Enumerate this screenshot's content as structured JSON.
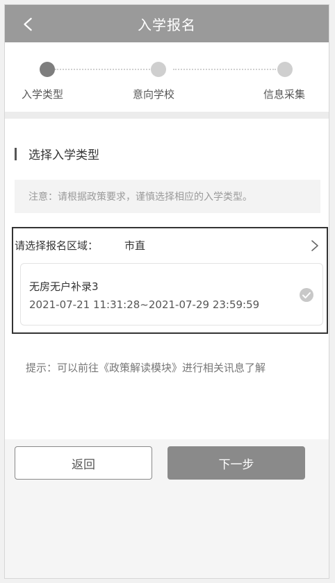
{
  "header": {
    "title": "入学报名",
    "back_icon": "chevron-left-icon"
  },
  "steps": [
    {
      "label": "入学类型",
      "active": true
    },
    {
      "label": "意向学校",
      "active": false
    },
    {
      "label": "信息采集",
      "active": false
    }
  ],
  "section": {
    "title": "选择入学类型",
    "notice": "注意：请根据政策要求，谨慎选择相应的入学类型。"
  },
  "region": {
    "label": "请选择报名区域：",
    "value": "市直"
  },
  "option": {
    "name": "无房无户补录3",
    "time": "2021-07-21 11:31:28~2021-07-29 23:59:59",
    "selected": true
  },
  "hint": "提示：可以前往《政策解读模块》进行相关讯息了解",
  "buttons": {
    "back": "返回",
    "next": "下一步"
  },
  "colors": {
    "header_bg": "#9a9a9a",
    "active_step": "#7e7e7e",
    "inactive_step": "#cfcfcf",
    "primary_button": "#8a8a8a"
  }
}
